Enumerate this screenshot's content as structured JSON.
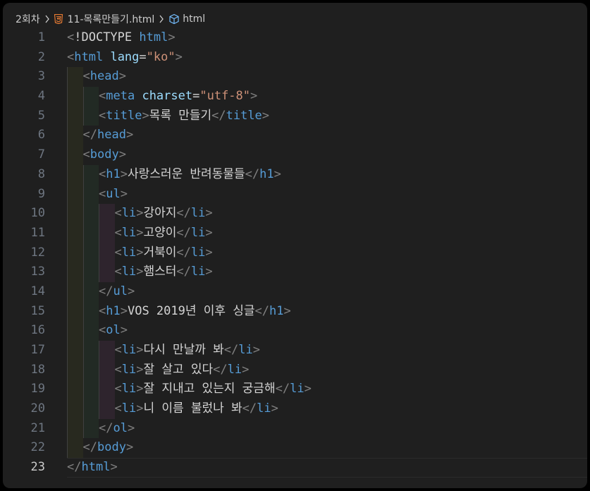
{
  "breadcrumb": {
    "folder": "2회차",
    "file": "11-목록만들기.html",
    "symbol": "html"
  },
  "colors": {
    "background": "#1f1f1f",
    "tag": "#569cd6",
    "attribute": "#9cdcfe",
    "string": "#ce9178",
    "text": "#d4d4d4",
    "bracket": "#808080",
    "line_number": "#6e7681"
  },
  "current_line": 23,
  "lines": [
    {
      "n": "1",
      "indent": 0,
      "tokens": [
        [
          "p",
          "<"
        ],
        [
          "x",
          "!DOCTYPE "
        ],
        [
          "t",
          "html"
        ],
        [
          "p",
          ">"
        ]
      ]
    },
    {
      "n": "2",
      "indent": 0,
      "tokens": [
        [
          "p",
          "<"
        ],
        [
          "t",
          "html"
        ],
        [
          "x",
          " "
        ],
        [
          "a",
          "lang"
        ],
        [
          "e",
          "="
        ],
        [
          "s",
          "\"ko\""
        ],
        [
          "p",
          ">"
        ]
      ]
    },
    {
      "n": "3",
      "indent": 1,
      "tokens": [
        [
          "p",
          "<"
        ],
        [
          "t",
          "head"
        ],
        [
          "p",
          ">"
        ]
      ]
    },
    {
      "n": "4",
      "indent": 2,
      "tokens": [
        [
          "p",
          "<"
        ],
        [
          "t",
          "meta"
        ],
        [
          "x",
          " "
        ],
        [
          "a",
          "charset"
        ],
        [
          "e",
          "="
        ],
        [
          "s",
          "\"utf-8\""
        ],
        [
          "p",
          ">"
        ]
      ]
    },
    {
      "n": "5",
      "indent": 2,
      "tokens": [
        [
          "p",
          "<"
        ],
        [
          "t",
          "title"
        ],
        [
          "p",
          ">"
        ],
        [
          "e",
          "목록 만들기"
        ],
        [
          "p",
          "</"
        ],
        [
          "t",
          "title"
        ],
        [
          "p",
          ">"
        ]
      ]
    },
    {
      "n": "6",
      "indent": 1,
      "tokens": [
        [
          "p",
          "</"
        ],
        [
          "t",
          "head"
        ],
        [
          "p",
          ">"
        ]
      ]
    },
    {
      "n": "7",
      "indent": 1,
      "tokens": [
        [
          "p",
          "<"
        ],
        [
          "t",
          "body"
        ],
        [
          "p",
          ">"
        ]
      ]
    },
    {
      "n": "8",
      "indent": 2,
      "tokens": [
        [
          "p",
          "<"
        ],
        [
          "t",
          "h1"
        ],
        [
          "p",
          ">"
        ],
        [
          "e",
          "사랑스러운 반려동물들"
        ],
        [
          "p",
          "</"
        ],
        [
          "t",
          "h1"
        ],
        [
          "p",
          ">"
        ]
      ]
    },
    {
      "n": "9",
      "indent": 2,
      "tokens": [
        [
          "p",
          "<"
        ],
        [
          "t",
          "ul"
        ],
        [
          "p",
          ">"
        ]
      ]
    },
    {
      "n": "10",
      "indent": 3,
      "tokens": [
        [
          "p",
          "<"
        ],
        [
          "t",
          "li"
        ],
        [
          "p",
          ">"
        ],
        [
          "e",
          "강아지"
        ],
        [
          "p",
          "</"
        ],
        [
          "t",
          "li"
        ],
        [
          "p",
          ">"
        ]
      ]
    },
    {
      "n": "11",
      "indent": 3,
      "tokens": [
        [
          "p",
          "<"
        ],
        [
          "t",
          "li"
        ],
        [
          "p",
          ">"
        ],
        [
          "e",
          "고양이"
        ],
        [
          "p",
          "</"
        ],
        [
          "t",
          "li"
        ],
        [
          "p",
          ">"
        ]
      ]
    },
    {
      "n": "12",
      "indent": 3,
      "tokens": [
        [
          "p",
          "<"
        ],
        [
          "t",
          "li"
        ],
        [
          "p",
          ">"
        ],
        [
          "e",
          "거북이"
        ],
        [
          "p",
          "</"
        ],
        [
          "t",
          "li"
        ],
        [
          "p",
          ">"
        ]
      ]
    },
    {
      "n": "13",
      "indent": 3,
      "tokens": [
        [
          "p",
          "<"
        ],
        [
          "t",
          "li"
        ],
        [
          "p",
          ">"
        ],
        [
          "e",
          "햄스터"
        ],
        [
          "p",
          "</"
        ],
        [
          "t",
          "li"
        ],
        [
          "p",
          ">"
        ]
      ]
    },
    {
      "n": "14",
      "indent": 2,
      "tokens": [
        [
          "p",
          "</"
        ],
        [
          "t",
          "ul"
        ],
        [
          "p",
          ">"
        ]
      ]
    },
    {
      "n": "15",
      "indent": 2,
      "tokens": [
        [
          "p",
          "<"
        ],
        [
          "t",
          "h1"
        ],
        [
          "p",
          ">"
        ],
        [
          "e",
          "VOS 2019년 이후 싱글"
        ],
        [
          "p",
          "</"
        ],
        [
          "t",
          "h1"
        ],
        [
          "p",
          ">"
        ]
      ]
    },
    {
      "n": "16",
      "indent": 2,
      "tokens": [
        [
          "p",
          "<"
        ],
        [
          "t",
          "ol"
        ],
        [
          "p",
          ">"
        ]
      ]
    },
    {
      "n": "17",
      "indent": 3,
      "tokens": [
        [
          "p",
          "<"
        ],
        [
          "t",
          "li"
        ],
        [
          "p",
          ">"
        ],
        [
          "e",
          "다시 만날까 봐"
        ],
        [
          "p",
          "</"
        ],
        [
          "t",
          "li"
        ],
        [
          "p",
          ">"
        ]
      ]
    },
    {
      "n": "18",
      "indent": 3,
      "tokens": [
        [
          "p",
          "<"
        ],
        [
          "t",
          "li"
        ],
        [
          "p",
          ">"
        ],
        [
          "e",
          "잘 살고 있다"
        ],
        [
          "p",
          "</"
        ],
        [
          "t",
          "li"
        ],
        [
          "p",
          ">"
        ]
      ]
    },
    {
      "n": "19",
      "indent": 3,
      "tokens": [
        [
          "p",
          "<"
        ],
        [
          "t",
          "li"
        ],
        [
          "p",
          ">"
        ],
        [
          "e",
          "잘 지내고 있는지 궁금해"
        ],
        [
          "p",
          "</"
        ],
        [
          "t",
          "li"
        ],
        [
          "p",
          ">"
        ]
      ]
    },
    {
      "n": "20",
      "indent": 3,
      "tokens": [
        [
          "p",
          "<"
        ],
        [
          "t",
          "li"
        ],
        [
          "p",
          ">"
        ],
        [
          "e",
          "니 이름 불렀나 봐"
        ],
        [
          "p",
          "</"
        ],
        [
          "t",
          "li"
        ],
        [
          "p",
          ">"
        ]
      ]
    },
    {
      "n": "21",
      "indent": 2,
      "tokens": [
        [
          "p",
          "</"
        ],
        [
          "t",
          "ol"
        ],
        [
          "p",
          ">"
        ]
      ]
    },
    {
      "n": "22",
      "indent": 1,
      "tokens": [
        [
          "p",
          "</"
        ],
        [
          "t",
          "body"
        ],
        [
          "p",
          ">"
        ]
      ]
    },
    {
      "n": "23",
      "indent": 0,
      "tokens": [
        [
          "p",
          "</"
        ],
        [
          "t",
          "html"
        ],
        [
          "p",
          ">"
        ]
      ]
    }
  ]
}
